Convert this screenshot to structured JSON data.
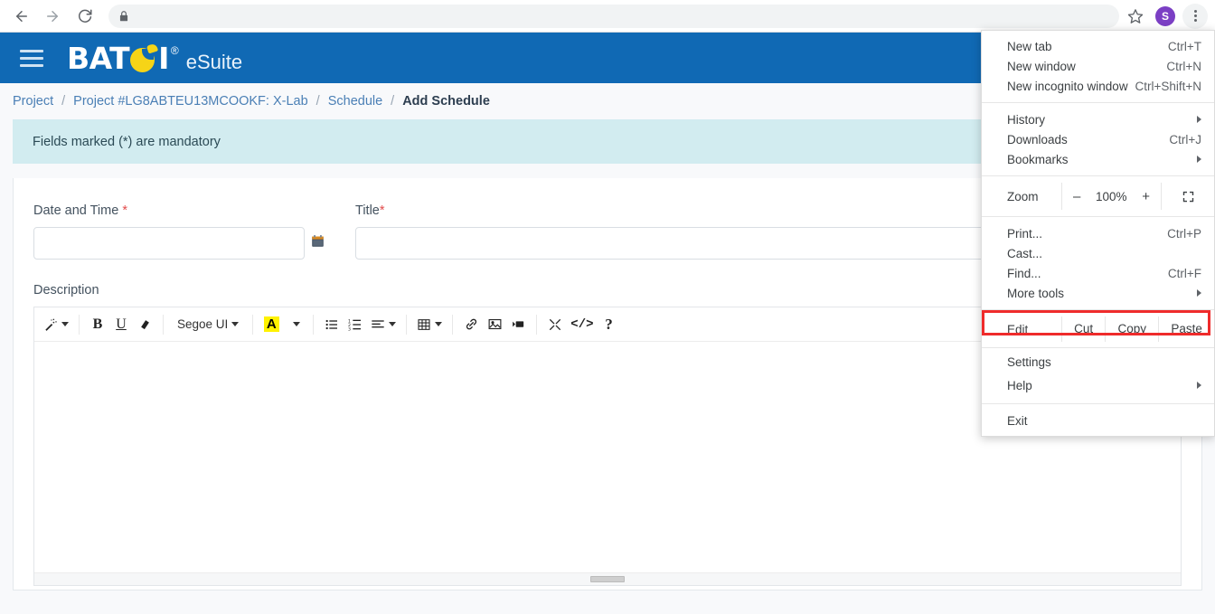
{
  "browser": {
    "back_label": "Back",
    "forward_label": "Forward",
    "reload_label": "Reload",
    "url_text": "",
    "lock_label": "Secure",
    "bookmark_label": "Bookmark this tab",
    "profile_initial": "S",
    "menu_label": "Customize and control Google Chrome"
  },
  "chrome_menu": {
    "items": [
      {
        "label": "New tab",
        "accel": "Ctrl+T",
        "submenu": false
      },
      {
        "label": "New window",
        "accel": "Ctrl+N",
        "submenu": false
      },
      {
        "label": "New incognito window",
        "accel": "Ctrl+Shift+N",
        "submenu": false
      },
      {
        "label": "History",
        "accel": "",
        "submenu": true
      },
      {
        "label": "Downloads",
        "accel": "Ctrl+J",
        "submenu": false
      },
      {
        "label": "Bookmarks",
        "accel": "",
        "submenu": true
      },
      {
        "label": "Print...",
        "accel": "Ctrl+P",
        "submenu": false
      },
      {
        "label": "Cast...",
        "accel": "",
        "submenu": false
      },
      {
        "label": "Find...",
        "accel": "Ctrl+F",
        "submenu": false
      },
      {
        "label": "More tools",
        "accel": "",
        "submenu": true
      },
      {
        "label": "Settings",
        "accel": "",
        "submenu": false
      },
      {
        "label": "Help",
        "accel": "",
        "submenu": true
      },
      {
        "label": "Exit",
        "accel": "",
        "submenu": false
      }
    ],
    "zoom": {
      "label": "Zoom",
      "minus": "–",
      "value": "100%",
      "plus": "+",
      "fullscreen_label": "Full screen"
    },
    "edit": {
      "label": "Edit",
      "cut": "Cut",
      "copy": "Copy",
      "paste": "Paste"
    },
    "highlight_color": "#ef2b2b",
    "highlighted_item": "Settings"
  },
  "app": {
    "header": {
      "brand_prefix": "BAT",
      "brand_suffix": "I",
      "registered": "®",
      "suite": "eSuite",
      "bg_color": "#1069b4",
      "logo_color": "#f6d417",
      "menu_label": "Main menu"
    },
    "breadcrumb": [
      {
        "label": "Project",
        "current": false
      },
      {
        "label": "Project #LG8ABTEU13MCOOKF: X-Lab",
        "current": false
      },
      {
        "label": "Schedule",
        "current": false
      },
      {
        "label": "Add Schedule",
        "current": true
      }
    ],
    "breadcrumb_separator": "/",
    "alert": {
      "text": "Fields marked (*) are mandatory",
      "bg_color": "#d2ecf0"
    },
    "form": {
      "date_time": {
        "label": "Date and Time",
        "required_mark": "*",
        "value": "",
        "placeholder": ""
      },
      "title": {
        "label": "Title",
        "required_mark": "*",
        "value": "",
        "placeholder": ""
      },
      "description": {
        "label": "Description",
        "value": ""
      }
    },
    "editor": {
      "font_name": "Segoe UI",
      "highlight_letter": "A",
      "buttons": [
        {
          "name": "magic-wand-icon",
          "glyph": "✨"
        },
        {
          "name": "bold-icon",
          "glyph": "B"
        },
        {
          "name": "underline-icon",
          "glyph": "U"
        },
        {
          "name": "eraser-icon",
          "glyph": "✐"
        },
        {
          "name": "bullet-list-icon",
          "glyph": "≡"
        },
        {
          "name": "numbered-list-icon",
          "glyph": "≣"
        },
        {
          "name": "align-icon",
          "glyph": "≡"
        },
        {
          "name": "table-icon",
          "glyph": "⊞"
        },
        {
          "name": "link-icon",
          "glyph": "🔗"
        },
        {
          "name": "image-icon",
          "glyph": "🖼"
        },
        {
          "name": "video-icon",
          "glyph": "▶"
        },
        {
          "name": "fullscreen-icon",
          "glyph": "⤢"
        },
        {
          "name": "code-icon",
          "glyph": "</>"
        },
        {
          "name": "help-icon",
          "glyph": "?"
        }
      ]
    }
  }
}
